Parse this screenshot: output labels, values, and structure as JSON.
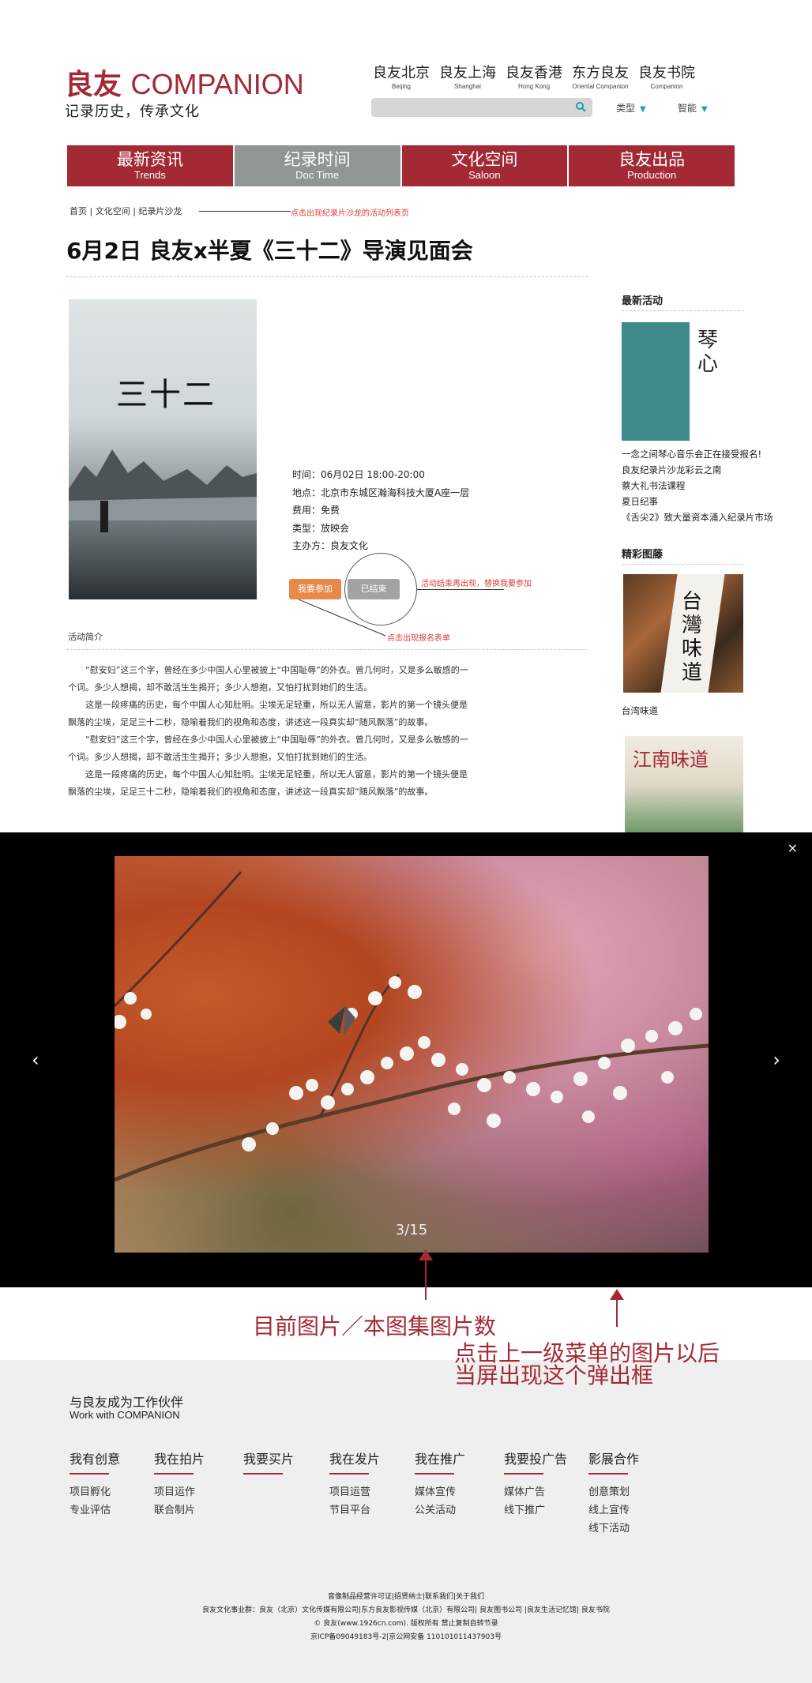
{
  "header": {
    "logo_cn": "良友",
    "logo_en": "COMPANION",
    "slogan": "记录历史，传承文化",
    "cities": [
      {
        "cn": "良友北京",
        "en": "Beijing"
      },
      {
        "cn": "良友上海",
        "en": "Shanghai"
      },
      {
        "cn": "良友香港",
        "en": "Hong Kong"
      },
      {
        "cn": "东方良友",
        "en": "Oriental Companion"
      },
      {
        "cn": "良友书院",
        "en": "Companion"
      }
    ],
    "filter_type": "类型",
    "filter_smart": "智能"
  },
  "nav": [
    {
      "cn": "最新资讯",
      "en": "Trends"
    },
    {
      "cn": "纪录时间",
      "en": "Doc Time"
    },
    {
      "cn": "文化空间",
      "en": "Saloon"
    },
    {
      "cn": "良友出品",
      "en": "Production"
    }
  ],
  "breadcrumb": [
    "首页",
    "文化空间",
    "纪录片沙龙"
  ],
  "annotations": {
    "crumb_note": "点击出现纪录片沙龙的活动列表页",
    "ended_note": "活动结束再出现，替换我要参加",
    "join_note": "点击出现报名表单",
    "counter_note": "目前图片／本图集图片数",
    "popup_note_1": "点击上一级菜单的图片以后",
    "popup_note_2": "当屏出现这个弹出框"
  },
  "event": {
    "title": "6月2日 良友x半夏《三十二》导演见面会",
    "poster_title": "三十二",
    "info": [
      "时间：06月02日  18:00-20:00",
      "地点：北京市东城区瀚海科技大厦A座一层",
      "费用：免费",
      "类型：放映会",
      "主办方：良友文化"
    ],
    "join_label": "我要参加",
    "ended_label": "已结束",
    "intro_heading": "活动简介",
    "paragraphs": [
      "“慰安妇”这三个字，曾经在多少中国人心里被披上“中国耻辱”的外衣。曾几何时，又是多么敏感的一个词。多少人想揭，却不敢活生生揭开；多少人想抱，又怕打扰到她们的生活。",
      "这是一段疼痛的历史，每个中国人心知肚明。尘埃无足轻重，所以无人留意，影片的第一个镜头便是飘落的尘埃，足足三十二秒，隐喻着我们的视角和态度，讲述这一段真实却“随风飘落”的故事。",
      "“慰安妇”这三个字，曾经在多少中国人心里被披上“中国耻辱”的外衣。曾几何时，又是多么敏感的一个词。多少人想揭，却不敢活生生揭开；多少人想抱，又怕打扰到她们的生活。",
      "这是一段疼痛的历史，每个中国人心知肚明。尘埃无足轻重，所以无人留意，影片的第一个镜头便是飘落的尘埃，足足三十二秒，隐喻着我们的视角和态度，讲述这一段真实却“随风飘落”的故事。"
    ]
  },
  "sidebar": {
    "latest_heading": "最新活动",
    "latest_items": [
      "一念之间琴心音乐会正在接受报名!",
      "良友纪录片沙龙彩云之南",
      "蔡大礼书法课程",
      "夏日纪事",
      "《舌尖2》致大量资本涌入纪录片市场"
    ],
    "gallery_heading": "精彩图藤",
    "gallery_caption": "台湾味道",
    "img1_text": "琴心",
    "img2_text": "台灣味道",
    "img3_text": "江南味道"
  },
  "lightbox": {
    "counter": "3/15",
    "close": "×",
    "prev": "‹",
    "next": "›"
  },
  "footer": {
    "partner_cn": "与良友成为工作伙伴",
    "partner_en": "Work with COMPANION",
    "columns": [
      {
        "heading": "我有创意",
        "items": [
          "项目孵化",
          "专业评估"
        ]
      },
      {
        "heading": "我在拍片",
        "items": [
          "项目运作",
          "联合制片"
        ]
      },
      {
        "heading": "我要买片",
        "items": []
      },
      {
        "heading": "我在发片",
        "items": [
          "项目运营",
          "节目平台"
        ]
      },
      {
        "heading": "我在推广",
        "items": [
          "媒体宣传",
          "公关活动"
        ]
      },
      {
        "heading": "我要投广告",
        "items": [
          "媒体广告",
          "线下推广"
        ]
      },
      {
        "heading": "影展合作",
        "items": [
          "创意策划",
          "线上宣传",
          "线下活动"
        ]
      }
    ],
    "legal": [
      "音像制品经营许可证|招贤纳士|联系我们|关于我们",
      "良友文化事业群：良友（北京）文化传媒有限公司|东方良友影视传媒（北京）有限公司| 良友图书公司 |良友生活记忆馆| 良友书院",
      "© 良友(www.1926cn.com). 版权所有 禁止复制自转节录",
      "京ICP备09049183号-2|京公网安备 110101011437903号"
    ]
  },
  "colors": {
    "brand": "#a32a35",
    "nav_active": "#8f9694",
    "join": "#e8894a",
    "ended": "#a3a3a3",
    "accent": "#1aa0b4"
  }
}
